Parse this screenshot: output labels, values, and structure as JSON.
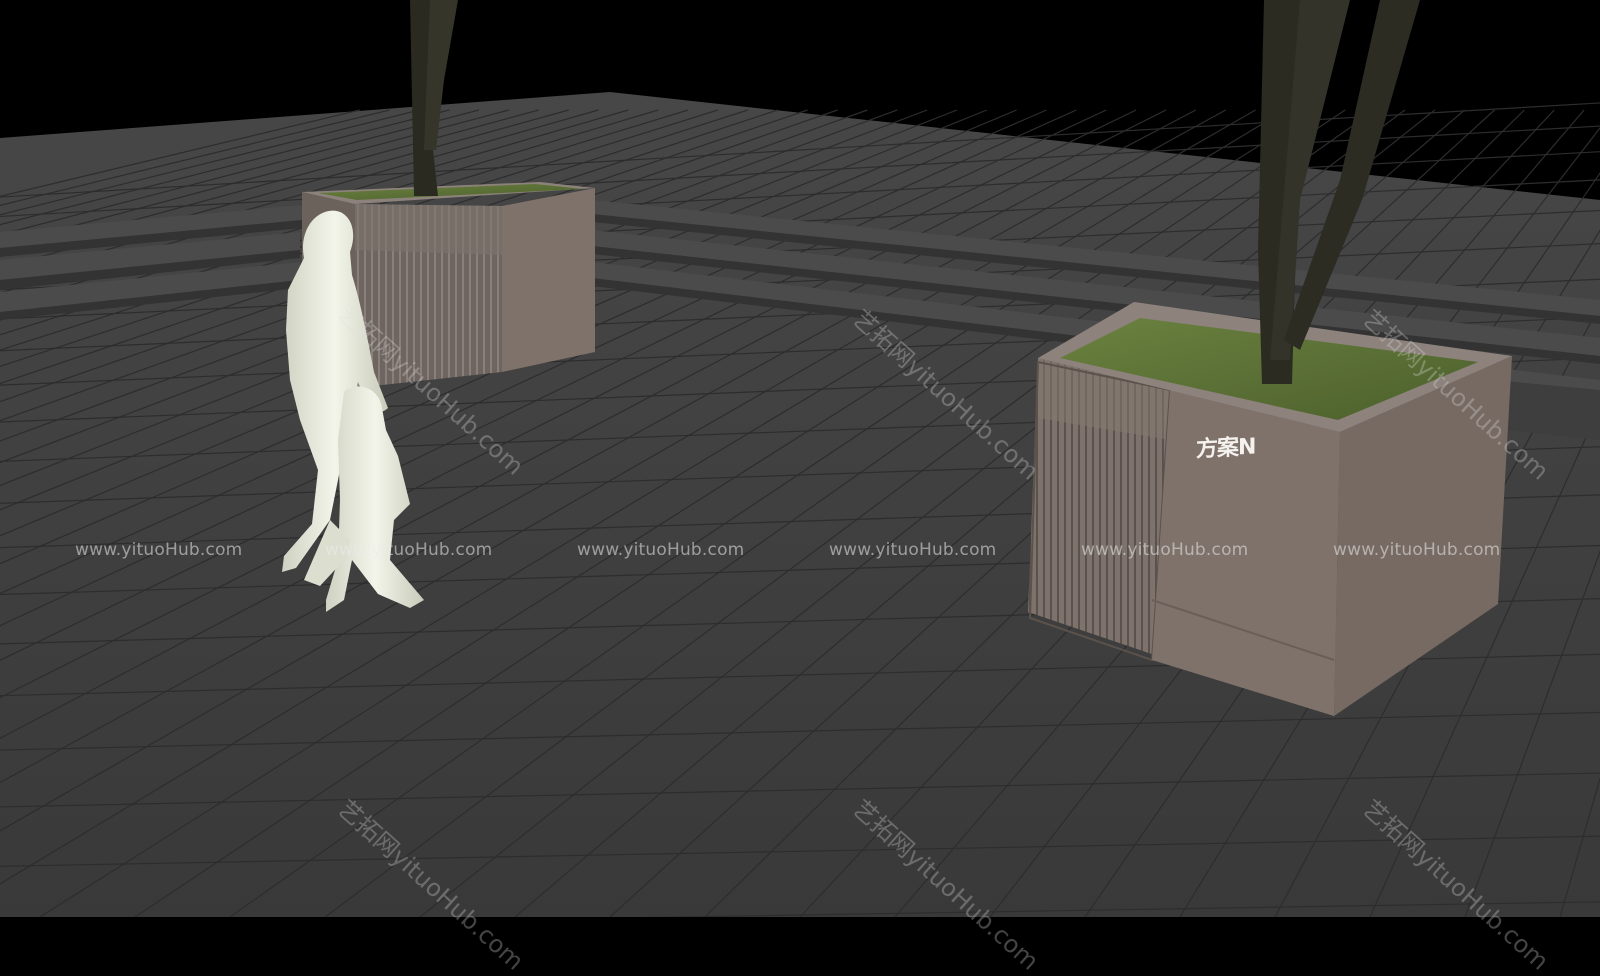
{
  "scene": {
    "colors": {
      "sky": "#000000",
      "paving": "#3c3c3c",
      "paving_grid": "#2b2b2b",
      "steps": "#4a4a4a",
      "planter": "#7f7169",
      "planter_dark": "#64574f",
      "grass": "#556b33",
      "trunk": "#2c2c22",
      "figure": "#e6e8da"
    },
    "planter_label": "方案N"
  },
  "watermark": {
    "url": "www.yituoHub.com",
    "diagonal": "艺拓网yituoHub.com"
  }
}
